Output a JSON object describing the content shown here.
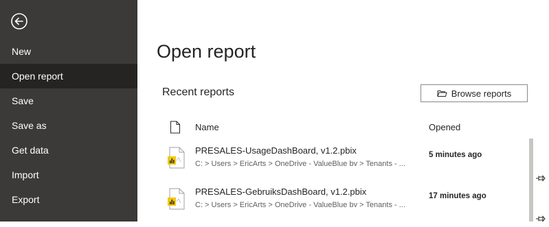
{
  "sidebar": {
    "back_icon": "arrow-left-circle-icon",
    "items": [
      {
        "label": "New",
        "active": false
      },
      {
        "label": "Open report",
        "active": true
      },
      {
        "label": "Save",
        "active": false
      },
      {
        "label": "Save as",
        "active": false
      },
      {
        "label": "Get data",
        "active": false
      },
      {
        "label": "Import",
        "active": false
      },
      {
        "label": "Export",
        "active": false
      }
    ]
  },
  "main": {
    "title": "Open report",
    "recent_title": "Recent reports",
    "browse_label": "Browse reports",
    "columns": {
      "name": "Name",
      "opened": "Opened"
    },
    "rows": [
      {
        "name": "PRESALES-UsageDashBoard, v1.2.pbix",
        "path": "C: > Users > EricArts > OneDrive - ValueBlue bv > Tenants - ...",
        "opened": "5 minutes ago"
      },
      {
        "name": "PRESALES-GebruiksDashBoard, v1.2.pbix",
        "path": "C: > Users > EricArts > OneDrive - ValueBlue bv > Tenants - ...",
        "opened": "17 minutes ago"
      }
    ]
  },
  "colors": {
    "sidebar_bg": "#3b3a39",
    "sidebar_active_bg": "#252423",
    "file_icon_accent": "#f2c811"
  }
}
